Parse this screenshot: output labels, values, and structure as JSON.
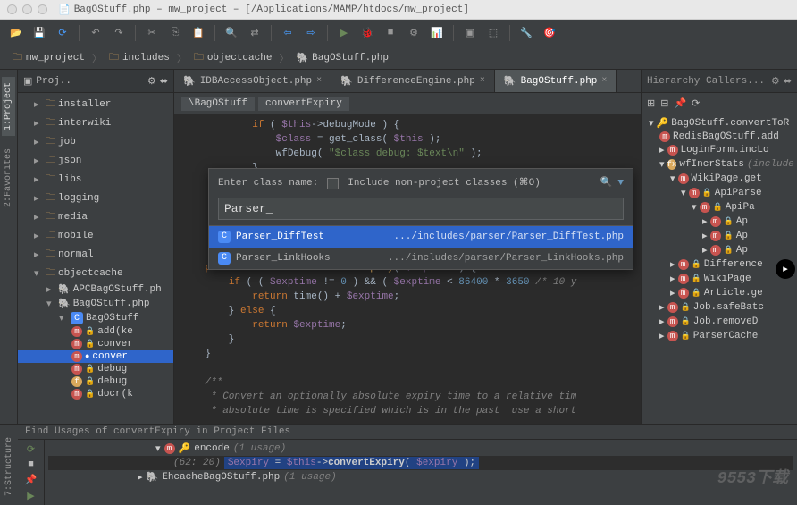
{
  "title": "BagOStuff.php – mw_project – [/Applications/MAMP/htdocs/mw_project]",
  "breadcrumbs": [
    "mw_project",
    "includes",
    "objectcache",
    "BagOStuff.php"
  ],
  "project_header": "Proj..",
  "tree": {
    "installer": "installer",
    "interwiki": "interwiki",
    "job": "job",
    "json": "json",
    "libs": "libs",
    "logging": "logging",
    "media": "media",
    "mobile": "mobile",
    "normal": "normal",
    "objectcache": "objectcache",
    "apc": "APCBagOStuff.ph",
    "bag": "BagOStuff.php",
    "class": "BagOStuff",
    "m_add": "add(ke",
    "m_conv1": "conver",
    "m_conv2": "conver",
    "m_debug": "debug",
    "m_debug2": "debug",
    "m_last": "docr(k"
  },
  "tabs": {
    "t1": "IDBAccessObject.php",
    "t2": "DifferenceEngine.php",
    "t3": "BagOStuff.php"
  },
  "nav_crumb": {
    "c1": "\\BagOStuff",
    "c2": "convertExpiry"
  },
  "code": {
    "l1": "            if ( $this->debugMode ) {",
    "l2": "                $class = get_class( $this );",
    "l3": "                wfDebug( \"$class debug: $text\\n\" );",
    "l4": "            }",
    "l5": "",
    "l6": "    protected function convertExpiry( $exptime ) {",
    "l7": "        if ( ( $exptime != 0 ) && ( $exptime < 86400 * 3650 /* 10 y",
    "l8": "            return time() + $exptime;",
    "l9": "        } else {",
    "l10": "            return $exptime;",
    "l11": "        }",
    "l12": "    }",
    "l13": "",
    "l14": "    /**",
    "l15": "     * Convert an optionally absolute expiry time to a relative tim",
    "l16": "     * absolute time is specified which is in the past  use a short"
  },
  "popup": {
    "label": "Enter class name:",
    "checkbox": "Include non-project classes (⌘O)",
    "input": "Parser_",
    "r1_name": "Parser_DiffTest",
    "r1_path": ".../includes/parser/Parser_DiffTest.php",
    "r2_name": "Parser_LinkHooks",
    "r2_path": ".../includes/parser/Parser_LinkHooks.php"
  },
  "hierarchy": {
    "title": "Hierarchy Callers...",
    "root": "BagOStuff.convertToR",
    "i1": "RedisBagOStuff.add",
    "i2": "LoginForm.incLo",
    "i3": "wfIncrStats",
    "i3b": "(include",
    "i4": "WikiPage.get",
    "i5": "ApiParse",
    "i6": "ApiPa",
    "i7": "Ap",
    "i8": "Ap",
    "i9": "Ap",
    "i10": "Difference",
    "i11": "WikiPage",
    "i12": "Article.ge",
    "i13": "Job.safeBatc",
    "i14": "Job.removeD",
    "i15": "ParserCache"
  },
  "usages": {
    "title": "Find Usages of convertExpiry in Project Files",
    "u1": "encode",
    "u1c": "(1 usage)",
    "u2_loc": "(62: 20)",
    "u2_code": "$expiry = $this->convertExpiry( $expiry );",
    "u3": "EhcacheBagOStuff.php",
    "u3c": "(1 usage)"
  },
  "watermark": "9553下载"
}
